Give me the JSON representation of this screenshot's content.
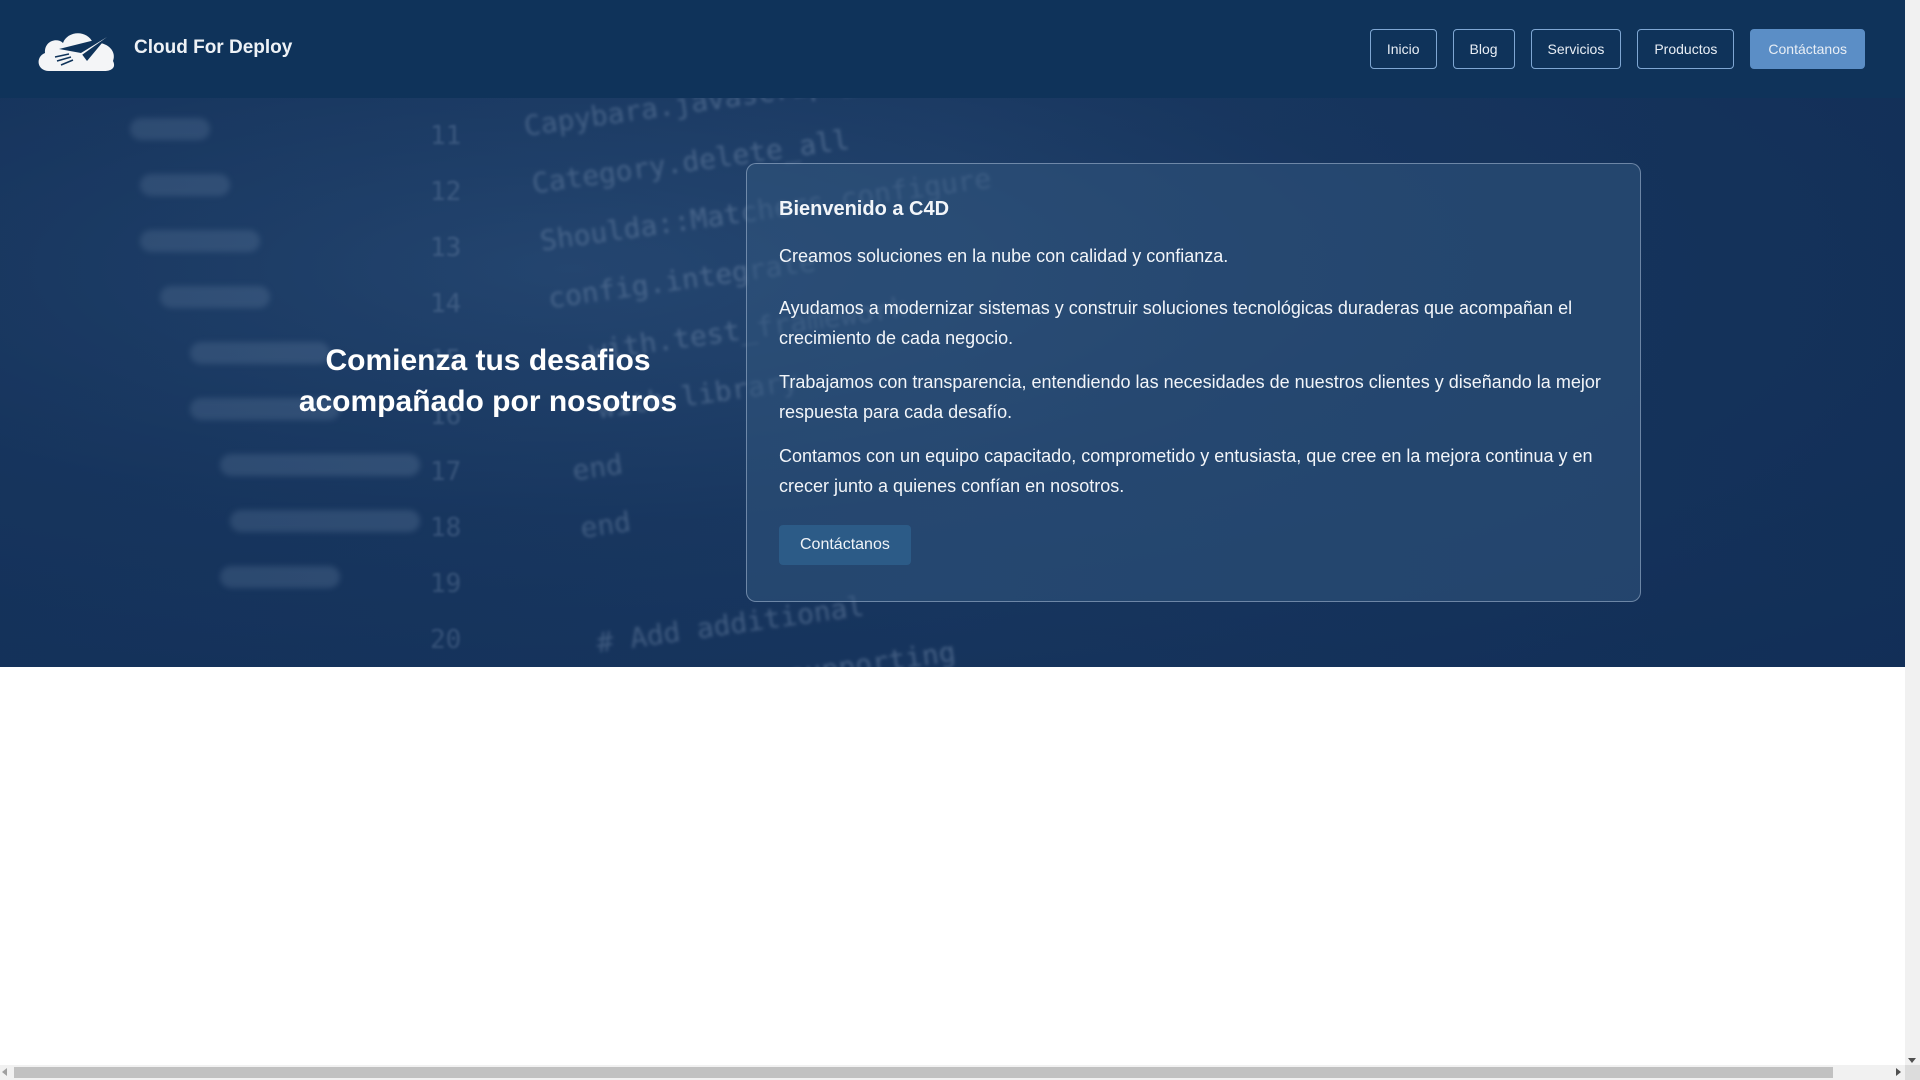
{
  "header": {
    "brand": "Cloud For Deploy",
    "nav": [
      {
        "label": "Inicio"
      },
      {
        "label": "Blog"
      },
      {
        "label": "Servicios"
      },
      {
        "label": "Productos"
      },
      {
        "label": "Contáctanos"
      }
    ]
  },
  "hero": {
    "title_line1": "Comienza tus desafios",
    "title_line2": "acompañado por nosotros"
  },
  "card": {
    "title": "Bienvenido a C4D",
    "paragraphs": [
      "Creamos soluciones en la nube con calidad y confianza.",
      "Ayudamos a modernizar sistemas y construir soluciones tecnológicas duraderas que acompañan el crecimiento de cada negocio.",
      "Trabajamos con transparencia, entendiendo las necesidades de nuestros clientes y diseñando la mejor respuesta para cada desafío.",
      "Contamos con un equipo capacitado, comprometido y entusiasta, que cree en la mejora continua y en crecer junto a quienes confían en nosotros."
    ],
    "button": "Contáctanos"
  },
  "colors": {
    "header": "#0f335a",
    "accent": "#5b8ec6",
    "cta": "#2c5b87"
  }
}
